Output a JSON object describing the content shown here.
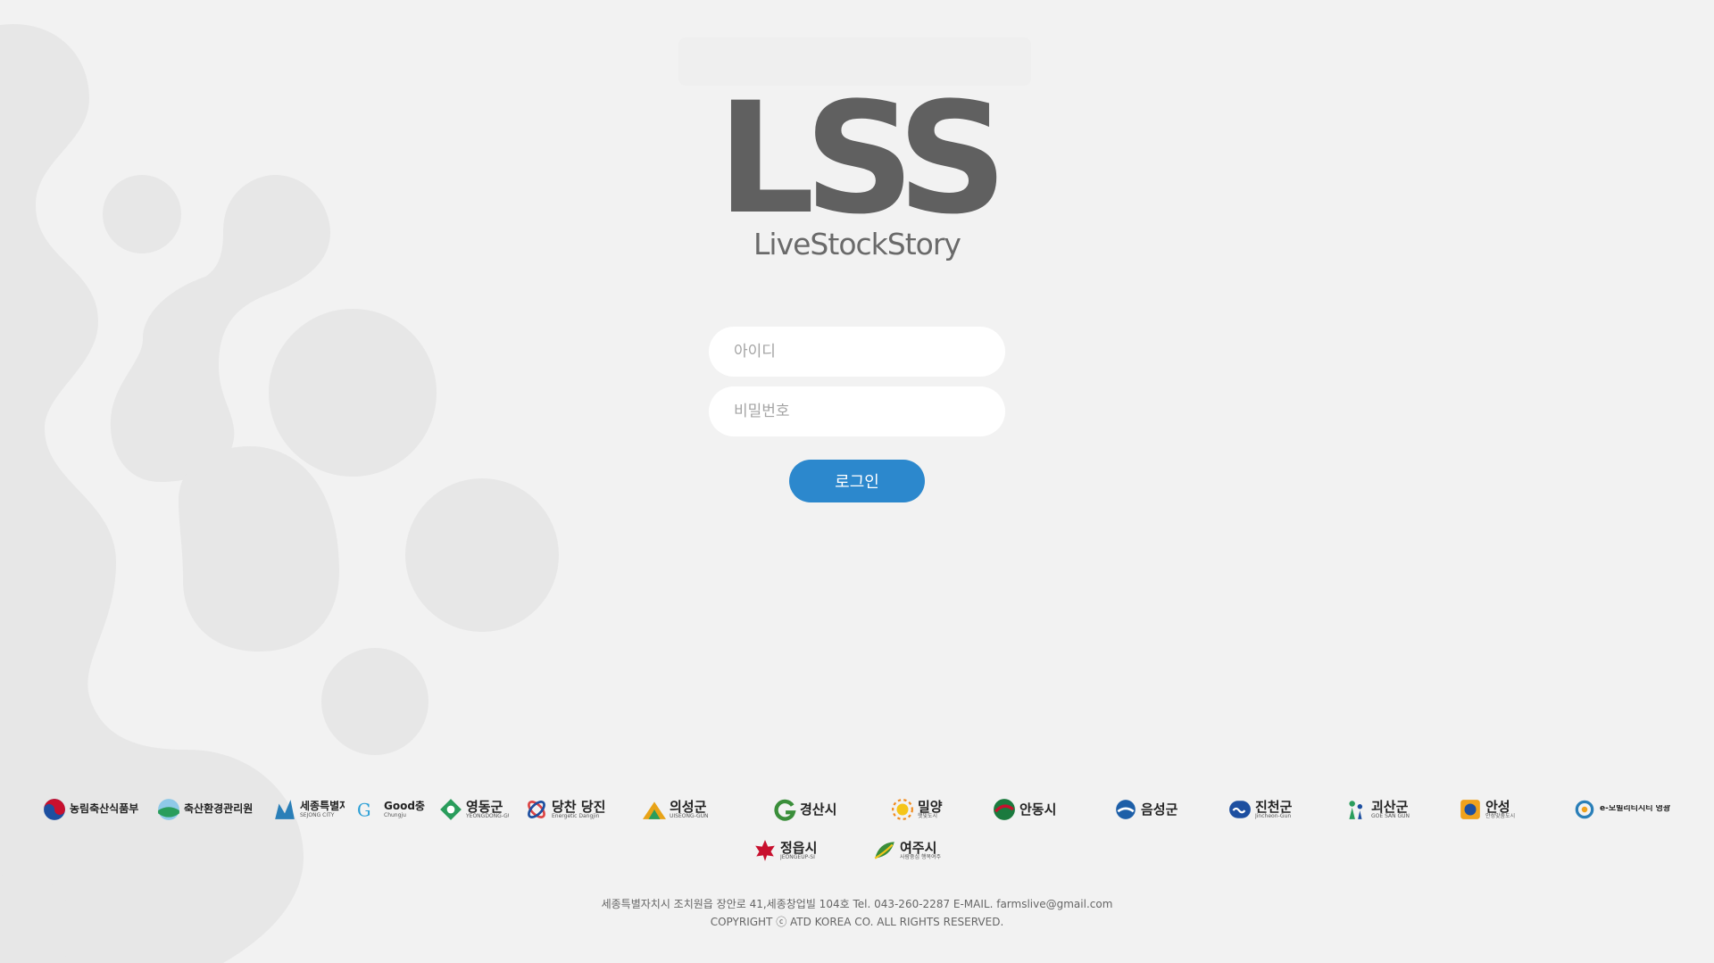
{
  "brand": {
    "logo": "LSS",
    "subtitle": "LiveStockStory"
  },
  "login": {
    "id_placeholder": "아이디",
    "id_value": "",
    "pw_placeholder": "비밀번호",
    "pw_value": "",
    "button_label": "로그인"
  },
  "partners": [
    {
      "name": "농림축산식품부",
      "icon": "taegeuk-icon",
      "color": "#c8102e"
    },
    {
      "name": "축산환경관리원",
      "icon": "globe-icon",
      "color": "#2a9d5c"
    },
    {
      "name": "세종특별자치시",
      "sub": "SEJONG CITY",
      "icon": "crown-icon",
      "color": "#2a7fb8"
    },
    {
      "name": "Good충주",
      "sub": "Chungju",
      "icon": "good-icon",
      "color": "#2a9fd6"
    },
    {
      "name": "영동군",
      "sub": "YEONGDONG-GUN",
      "icon": "diamond-icon",
      "color": "#2a9d5c"
    },
    {
      "name": "당찬 당진",
      "sub": "Energetic Dangjin",
      "icon": "knot-icon",
      "color": "#d44"
    },
    {
      "name": "의성군",
      "sub": "UISEONG-GUN",
      "icon": "mountain-icon",
      "color": "#e8a317"
    },
    {
      "name": "경산시",
      "icon": "g-swirl-icon",
      "color": "#3a8e3a"
    },
    {
      "name": "밀양",
      "sub": "햇빛도시",
      "icon": "sun-icon",
      "color": "#f08b1d"
    },
    {
      "name": "안동시",
      "icon": "wave-icon",
      "color": "#1b7a3e"
    },
    {
      "name": "음성군",
      "icon": "drop-icon",
      "color": "#1d5fa8"
    },
    {
      "name": "진천군",
      "sub": "Jincheon-Gun",
      "icon": "cloud-icon",
      "color": "#1d4fa0"
    },
    {
      "name": "괴산군",
      "sub": "GOE SAN GUN",
      "icon": "people-icon",
      "color": "#2a9d5c"
    },
    {
      "name": "안성",
      "sub": "안성맞춤도시",
      "icon": "square-icon",
      "color": "#1d4fa0"
    },
    {
      "name": "e-모빌리티시티 영광",
      "icon": "mobility-icon",
      "color": "#2a7fb8"
    },
    {
      "name": "정읍시",
      "sub": "JEONGEUP-SI",
      "icon": "maple-icon",
      "color": "#c8102e"
    },
    {
      "name": "여주시",
      "sub": "사람중심 행복여주",
      "icon": "leaf-icon",
      "color": "#3a8e3a"
    }
  ],
  "footer": {
    "address": "세종특별자치시 조치원읍 장안로 41,세종창업빌 104호 Tel. 043-260-2287 E-MAIL. farmslive@gmail.com",
    "copyright": "COPYRIGHT ⓒ ATD KOREA CO. ALL RIGHTS RESERVED."
  },
  "colors": {
    "background": "#f2f2f2",
    "blob": "#e6e6e6",
    "logo": "#606060",
    "accent": "#2c88cd"
  }
}
